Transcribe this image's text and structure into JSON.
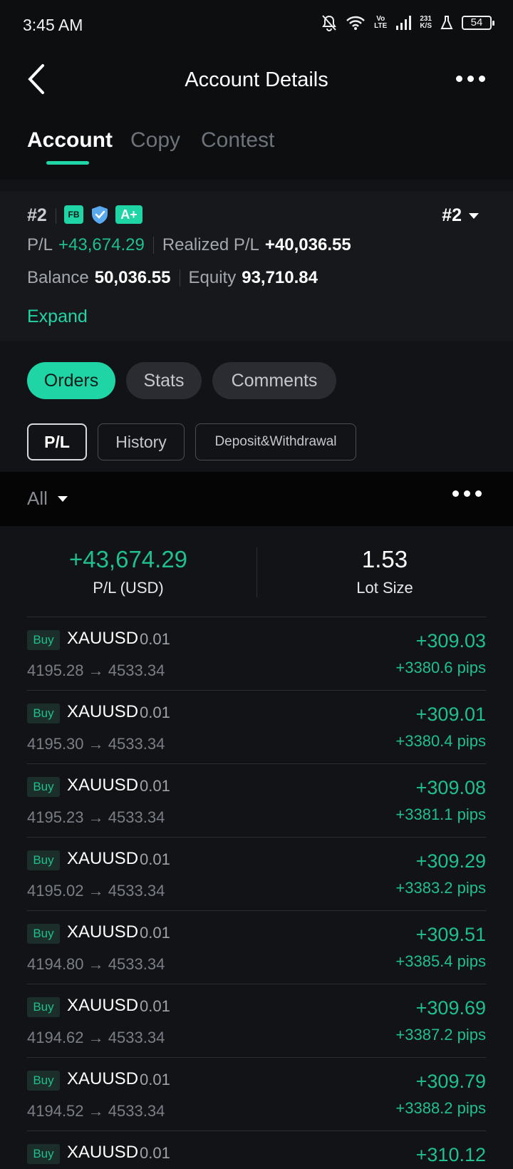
{
  "status_bar": {
    "time": "3:45 AM",
    "icons": [
      "mute-icon",
      "wifi-icon",
      "volte-icon",
      "signal-icon",
      "network-speed",
      "lab-icon",
      "battery-icon"
    ],
    "volte_top": "Vo",
    "volte_bottom": "LTE",
    "speed_value": "231",
    "speed_unit": "K/S",
    "battery": "54"
  },
  "header": {
    "title": "Account Details"
  },
  "top_tabs": [
    {
      "label": "Account",
      "active": true
    },
    {
      "label": "Copy",
      "active": false
    },
    {
      "label": "Contest",
      "active": false
    }
  ],
  "account": {
    "rank": "#2",
    "badges": {
      "fb": "FB",
      "grade": "A+"
    },
    "rank_select": "#2",
    "pl_label": "P/L",
    "pl_value": "+43,674.29",
    "realized_label": "Realized P/L",
    "realized_value": "+40,036.55",
    "balance_label": "Balance",
    "balance_value": "50,036.55",
    "equity_label": "Equity",
    "equity_value": "93,710.84",
    "expand_label": "Expand"
  },
  "section_tabs": [
    {
      "label": "Orders",
      "active": true
    },
    {
      "label": "Stats",
      "active": false
    },
    {
      "label": "Comments",
      "active": false
    }
  ],
  "sub_tabs": [
    {
      "label": "P/L",
      "active": true
    },
    {
      "label": "History",
      "active": false
    },
    {
      "label": "Deposit&Withdrawal",
      "active": false
    }
  ],
  "filter": {
    "selected": "All"
  },
  "summary": {
    "pl_value": "+43,674.29",
    "pl_label": "P/L (USD)",
    "lot_value": "1.53",
    "lot_label": "Lot Size"
  },
  "orders": [
    {
      "side": "Buy",
      "symbol": "XAUUSD",
      "lots": "0.01",
      "open": "4195.28",
      "close": "4533.34",
      "pnl": "+309.03",
      "pips": "+3380.6 pips"
    },
    {
      "side": "Buy",
      "symbol": "XAUUSD",
      "lots": "0.01",
      "open": "4195.30",
      "close": "4533.34",
      "pnl": "+309.01",
      "pips": "+3380.4 pips"
    },
    {
      "side": "Buy",
      "symbol": "XAUUSD",
      "lots": "0.01",
      "open": "4195.23",
      "close": "4533.34",
      "pnl": "+309.08",
      "pips": "+3381.1 pips"
    },
    {
      "side": "Buy",
      "symbol": "XAUUSD",
      "lots": "0.01",
      "open": "4195.02",
      "close": "4533.34",
      "pnl": "+309.29",
      "pips": "+3383.2 pips"
    },
    {
      "side": "Buy",
      "symbol": "XAUUSD",
      "lots": "0.01",
      "open": "4194.80",
      "close": "4533.34",
      "pnl": "+309.51",
      "pips": "+3385.4 pips"
    },
    {
      "side": "Buy",
      "symbol": "XAUUSD",
      "lots": "0.01",
      "open": "4194.62",
      "close": "4533.34",
      "pnl": "+309.69",
      "pips": "+3387.2 pips"
    },
    {
      "side": "Buy",
      "symbol": "XAUUSD",
      "lots": "0.01",
      "open": "4194.52",
      "close": "4533.34",
      "pnl": "+309.79",
      "pips": "+3388.2 pips"
    },
    {
      "side": "Buy",
      "symbol": "XAUUSD",
      "lots": "0.01",
      "open": "",
      "close": "",
      "pnl": "+310.12",
      "pips": ""
    }
  ],
  "colors": {
    "accent": "#1fd5a6",
    "profit": "#1fbf8e",
    "background": "#121316"
  }
}
